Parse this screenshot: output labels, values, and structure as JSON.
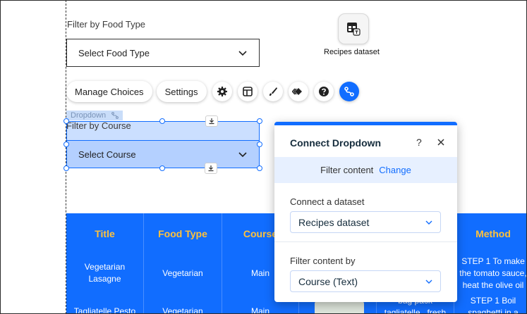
{
  "canvas": {
    "food_type_label": "Filter by Food Type",
    "food_type_select": "Select Food Type",
    "course_label": "Filter by Course",
    "course_select": "Select Course",
    "dataset_label": "Recipes dataset",
    "element_tag": "Dropdown"
  },
  "toolbar": {
    "manage_choices": "Manage Choices",
    "settings": "Settings",
    "icons": [
      "gear-icon",
      "layout-icon",
      "design-brush-icon",
      "animation-icon",
      "help-icon",
      "connect-data-icon"
    ]
  },
  "table": {
    "columns": [
      {
        "title": "Title",
        "cells": [
          "Vegetarian\nLasagne",
          "Tagliatelle Pesto"
        ]
      },
      {
        "title": "Food Type",
        "cells": [
          "Vegetarian",
          "Vegetarian"
        ]
      },
      {
        "title": "Course",
        "cells": [
          "Main",
          "Main"
        ]
      },
      {
        "title": "",
        "cells": [
          "",
          ""
        ]
      },
      {
        "title": "",
        "cells": [
          "",
          "bag pack\ntagliatelle , fresh"
        ]
      },
      {
        "title": "Method",
        "cells": [
          "STEP 1 To make\nthe tomato sauce,\nheat the olive oil",
          "STEP 1 Boil\nspaghetti in a"
        ]
      }
    ]
  },
  "panel": {
    "title": "Connect Dropdown",
    "help": "?",
    "filter_text": "Filter content",
    "filter_link": "Change",
    "dataset_label": "Connect a dataset",
    "dataset_value": "Recipes dataset",
    "filter_by_label": "Filter content by",
    "filter_by_value": "Course (Text)"
  },
  "colors": {
    "accent": "#116dff",
    "table_bg": "#116dff",
    "table_header": "#ffc13b",
    "selection": "#c9ddf9"
  }
}
